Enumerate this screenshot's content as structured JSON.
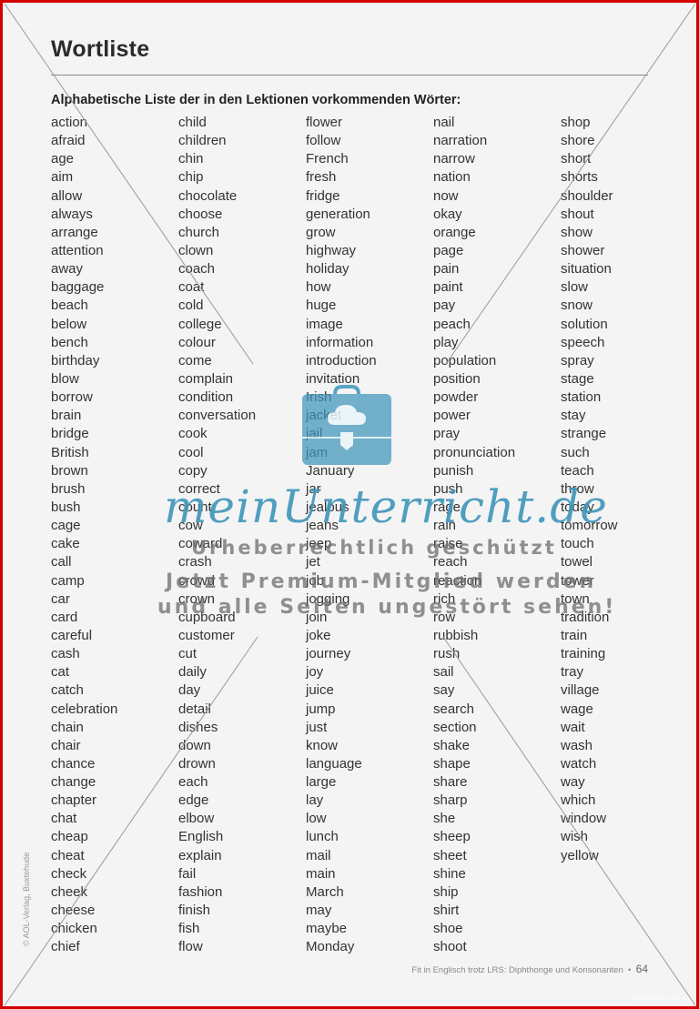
{
  "page": {
    "title": "Wortliste",
    "subtitle": "Alphabetische Liste der in den Lektionen vorkommenden Wörter:",
    "columns": [
      [
        "action",
        "afraid",
        "age",
        "aim",
        "allow",
        "always",
        "arrange",
        "attention",
        "away",
        "baggage",
        "beach",
        "below",
        "bench",
        "birthday",
        "blow",
        "borrow",
        "brain",
        "bridge",
        "British",
        "brown",
        "brush",
        "bush",
        "cage",
        "cake",
        "call",
        "camp",
        "car",
        "card",
        "careful",
        "cash",
        "cat",
        "catch",
        "celebration",
        "chain",
        "chair",
        "chance",
        "change",
        "chapter",
        "chat",
        "cheap",
        "cheat",
        "check",
        "cheek",
        "cheese",
        "chicken",
        "chief"
      ],
      [
        "child",
        "children",
        "chin",
        "chip",
        "chocolate",
        "choose",
        "church",
        "clown",
        "coach",
        "coat",
        "cold",
        "college",
        "colour",
        "come",
        "complain",
        "condition",
        "conversation",
        "cook",
        "cool",
        "copy",
        "correct",
        "count",
        "cow",
        "coward",
        "crash",
        "crowd",
        "crown",
        "cupboard",
        "customer",
        "cut",
        "daily",
        "day",
        "detail",
        "dishes",
        "down",
        "drown",
        "each",
        "edge",
        "elbow",
        "English",
        "explain",
        "fail",
        "fashion",
        "finish",
        "fish",
        "flow"
      ],
      [
        "flower",
        "follow",
        "French",
        "fresh",
        "fridge",
        "generation",
        "grow",
        "highway",
        "holiday",
        "how",
        "huge",
        "image",
        "information",
        "introduction",
        "invitation",
        "Irish",
        "jacket",
        "jail",
        "jam",
        "January",
        "jar",
        "jealous",
        "jeans",
        "jeep",
        "jet",
        "job",
        "jogging",
        "join",
        "joke",
        "journey",
        "joy",
        "juice",
        "jump",
        "just",
        "know",
        "language",
        "large",
        "lay",
        "low",
        "lunch",
        "mail",
        "main",
        "March",
        "may",
        "maybe",
        "Monday"
      ],
      [
        "nail",
        "narration",
        "narrow",
        "nation",
        "now",
        "okay",
        "orange",
        "page",
        "pain",
        "paint",
        "pay",
        "peach",
        "play",
        "population",
        "position",
        "powder",
        "power",
        "pray",
        "pronunciation",
        "punish",
        "push",
        "rage",
        "rain",
        "raise",
        "reach",
        "reaction",
        "rich",
        "row",
        "rubbish",
        "rush",
        "sail",
        "say",
        "search",
        "section",
        "shake",
        "shape",
        "share",
        "sharp",
        "she",
        "sheep",
        "sheet",
        "shine",
        "ship",
        "shirt",
        "shoe",
        "shoot"
      ],
      [
        "shop",
        "shore",
        "short",
        "shorts",
        "shoulder",
        "shout",
        "show",
        "shower",
        "situation",
        "slow",
        "snow",
        "solution",
        "speech",
        "spray",
        "stage",
        "station",
        "stay",
        "strange",
        "such",
        "teach",
        "throw",
        "today",
        "tomorrow",
        "touch",
        "towel",
        "tower",
        "town",
        "tradition",
        "train",
        "training",
        "tray",
        "village",
        "wage",
        "wait",
        "wash",
        "watch",
        "way",
        "which",
        "window",
        "wish",
        "yellow"
      ]
    ],
    "copyright": "© AOL-Verlag, Buxtehude",
    "footer_text": "Fit in Englisch trotz LRS: Diphthonge und Konsonanten",
    "footer_separator": "•",
    "page_number": "64"
  },
  "watermark": {
    "brand": "meinUnterricht.de",
    "line1": "Urheberrechtlich geschützt",
    "line2": "Jetzt Premium-Mitglied werden",
    "line3": "und alle Seiten ungestört sehen!",
    "corner": "meinUnterricht.de",
    "color": "#3f95ba"
  },
  "frame": {
    "border_color": "#d40000"
  }
}
